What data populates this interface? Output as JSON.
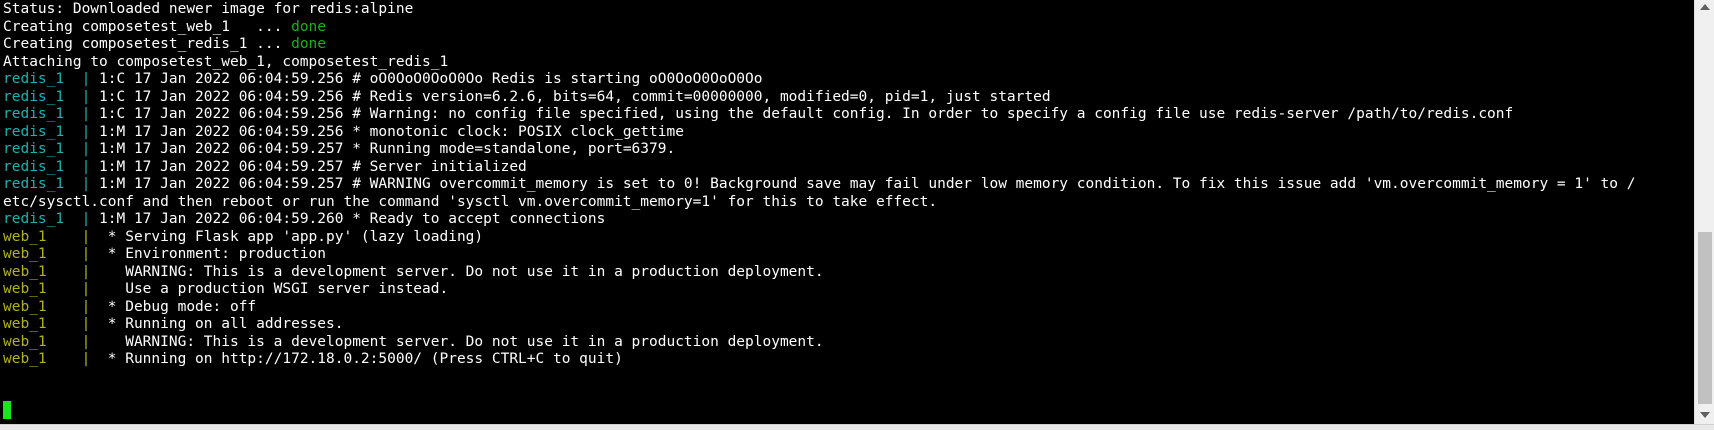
{
  "terminal": {
    "colors": {
      "background": "#000000",
      "text": "#ffffff",
      "done": "#18b218",
      "redis_prefix": "#18b2b2",
      "web_prefix": "#b2b218",
      "cursor": "#1ee31e"
    },
    "lines": [
      {
        "prefix": "",
        "text": "Status: Downloaded newer image for redis:alpine"
      },
      {
        "prefix": "",
        "text": "Creating composetest_web_1   ... ",
        "status": "done"
      },
      {
        "prefix": "",
        "text": "Creating composetest_redis_1 ... ",
        "status": "done"
      },
      {
        "prefix": "",
        "text": "Attaching to composetest_web_1, composetest_redis_1"
      },
      {
        "prefix": "redis_1  | ",
        "text": "1:C 17 Jan 2022 06:04:59.256 # oO0OoO0OoO0Oo Redis is starting oO0OoO0OoO0Oo"
      },
      {
        "prefix": "redis_1  | ",
        "text": "1:C 17 Jan 2022 06:04:59.256 # Redis version=6.2.6, bits=64, commit=00000000, modified=0, pid=1, just started"
      },
      {
        "prefix": "redis_1  | ",
        "text": "1:C 17 Jan 2022 06:04:59.256 # Warning: no config file specified, using the default config. In order to specify a config file use redis-server /path/to/redis.conf"
      },
      {
        "prefix": "redis_1  | ",
        "text": "1:M 17 Jan 2022 06:04:59.256 * monotonic clock: POSIX clock_gettime"
      },
      {
        "prefix": "redis_1  | ",
        "text": "1:M 17 Jan 2022 06:04:59.257 * Running mode=standalone, port=6379."
      },
      {
        "prefix": "redis_1  | ",
        "text": "1:M 17 Jan 2022 06:04:59.257 # Server initialized"
      },
      {
        "prefix": "redis_1  | ",
        "text": "1:M 17 Jan 2022 06:04:59.257 # WARNING overcommit_memory is set to 0! Background save may fail under low memory condition. To fix this issue add 'vm.overcommit_memory = 1' to /"
      },
      {
        "prefix": "",
        "text": "etc/sysctl.conf and then reboot or run the command 'sysctl vm.overcommit_memory=1' for this to take effect."
      },
      {
        "prefix": "redis_1  | ",
        "text": "1:M 17 Jan 2022 06:04:59.260 * Ready to accept connections"
      },
      {
        "prefix": "web_1    | ",
        "text": " * Serving Flask app 'app.py' (lazy loading)"
      },
      {
        "prefix": "web_1    | ",
        "text": " * Environment: production"
      },
      {
        "prefix": "web_1    | ",
        "text": "   WARNING: This is a development server. Do not use it in a production deployment."
      },
      {
        "prefix": "web_1    | ",
        "text": "   Use a production WSGI server instead."
      },
      {
        "prefix": "web_1    | ",
        "text": " * Debug mode: off"
      },
      {
        "prefix": "web_1    | ",
        "text": " * Running on all addresses."
      },
      {
        "prefix": "web_1    | ",
        "text": "   WARNING: This is a development server. Do not use it in a production deployment."
      },
      {
        "prefix": "web_1    | ",
        "text": " * Running on http://172.18.0.2:5000/ (Press CTRL+C to quit)"
      }
    ]
  },
  "scrollbar": {
    "up_icon": "scroll-up-arrow-icon",
    "down_icon": "scroll-down-arrow-icon"
  }
}
